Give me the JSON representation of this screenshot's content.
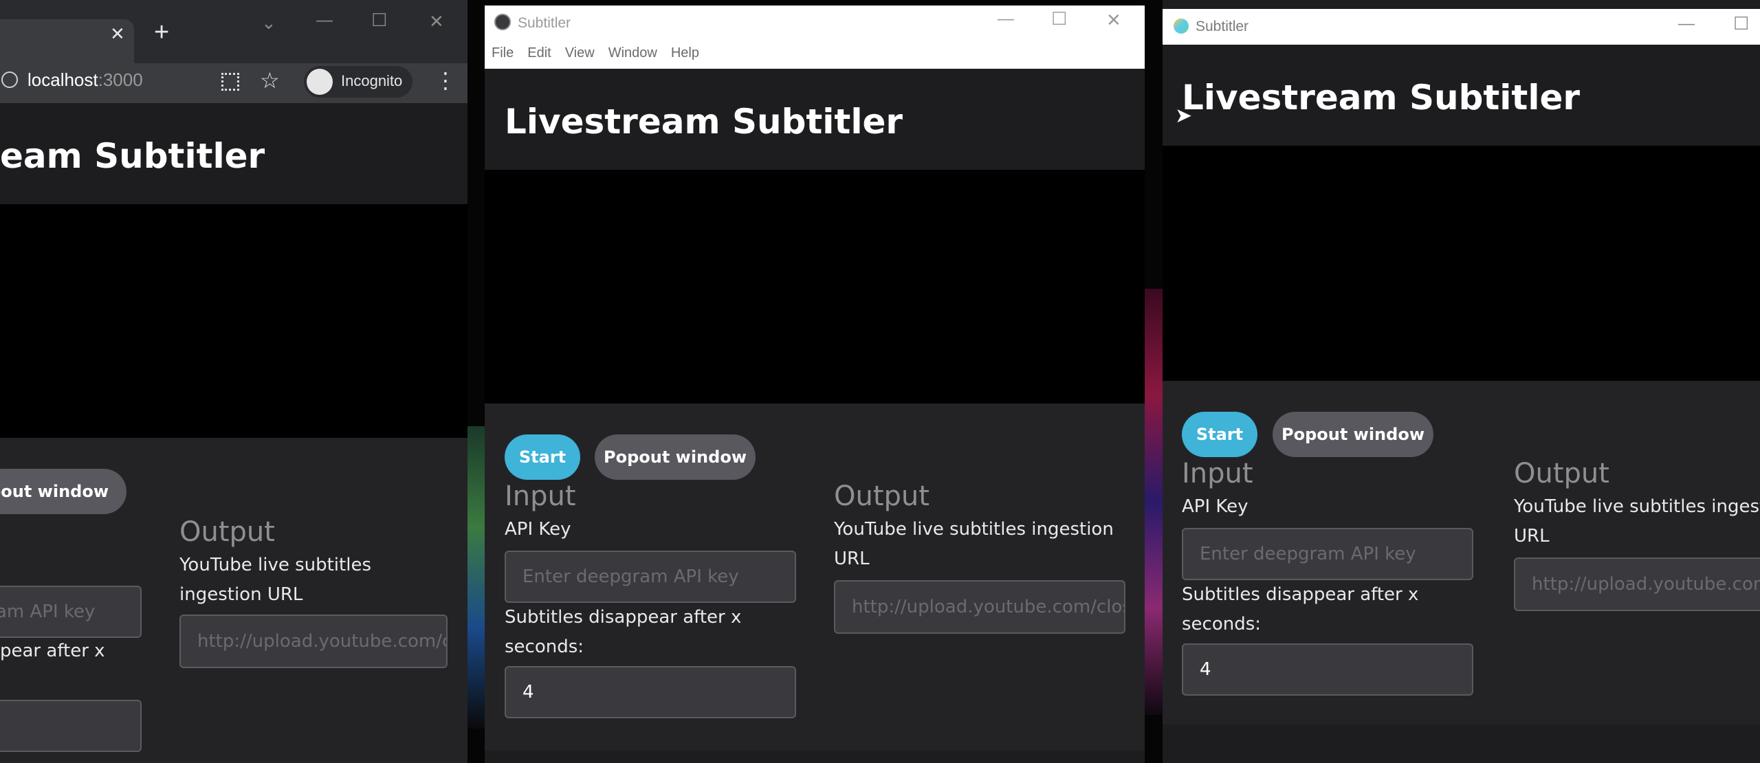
{
  "browser": {
    "tab_close_glyph": "✕",
    "new_tab_glyph": "+",
    "url": "localhost",
    "url_port": ":3000",
    "profile_label": "Incognito",
    "window_controls": [
      "⌄",
      "—",
      "☐",
      "✕"
    ]
  },
  "electron_window": {
    "title": "Subtitler",
    "menu": [
      "File",
      "Edit",
      "View",
      "Window",
      "Help"
    ],
    "window_controls": [
      "—",
      "☐",
      "✕"
    ]
  },
  "popout_window": {
    "title": "Subtitler",
    "window_controls": [
      "—",
      "☐"
    ]
  },
  "app": {
    "title": "Livestream Subtitler",
    "title_cropped": "eam Subtitler",
    "start_label": "Start",
    "popout_label": "Popout window",
    "popout_label_cropped": "opout window",
    "input_heading": "Input",
    "output_heading": "Output",
    "api_key_label": "API Key",
    "api_key_placeholder": "Enter deepgram API key",
    "api_key_placeholder_cropped": "am API key",
    "disappear_label": "Subtitles disappear after x seconds:",
    "disappear_label_cropped": "pear after x",
    "disappear_value": "4",
    "output_label": "YouTube live subtitles ingestion URL",
    "output_label_cropped": "YouTube live subtitles ingest",
    "output_label_url_line": "URL",
    "output_placeholder": "http://upload.youtube.com/closedcaption"
  },
  "colors": {
    "accent_start": "#3fb3d8",
    "button_secondary": "#58585e",
    "header_bg": "#1d1d20",
    "panel_bg": "#232326",
    "video_bg": "#000000"
  }
}
